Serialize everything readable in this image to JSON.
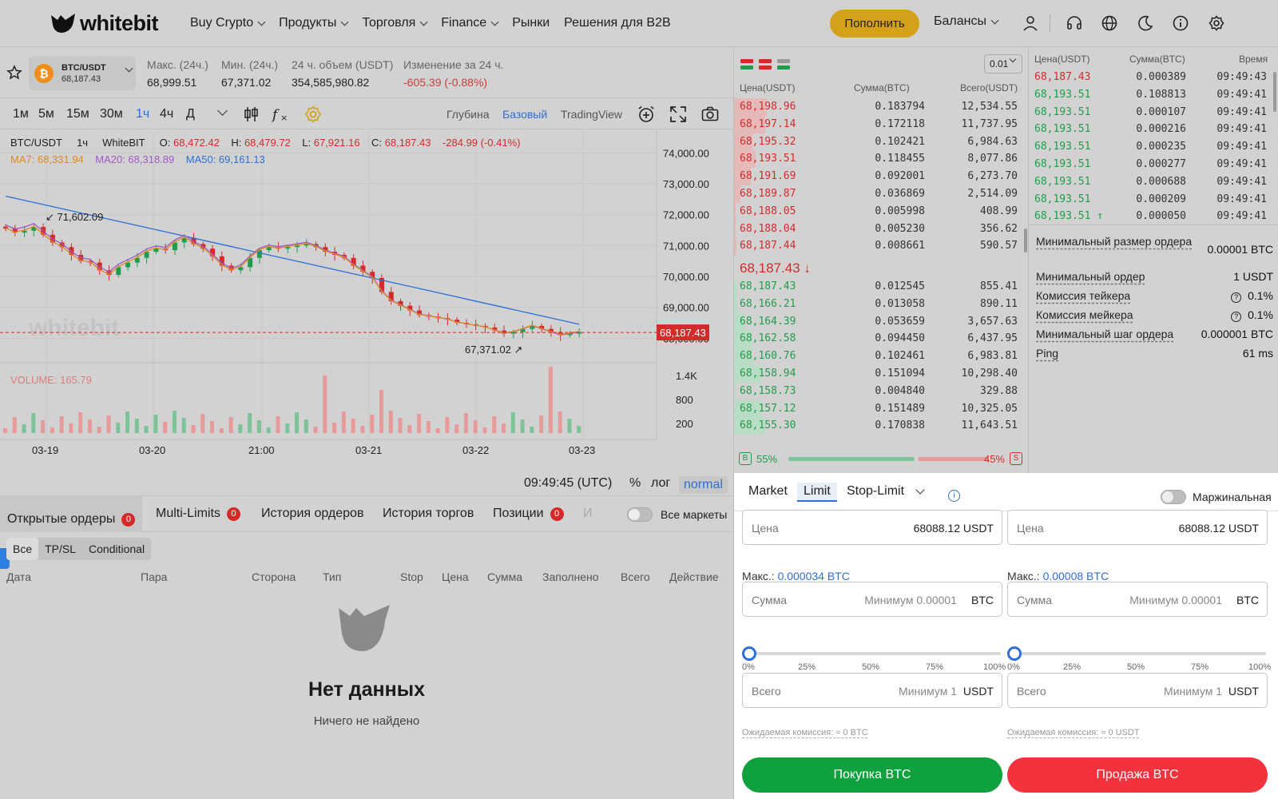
{
  "header": {
    "logo_text": "whitebit",
    "nav": [
      {
        "label": "Buy Crypto",
        "dropdown": true
      },
      {
        "label": "Продукты",
        "dropdown": true
      },
      {
        "label": "Торговля",
        "dropdown": true
      },
      {
        "label": "Finance",
        "dropdown": true
      },
      {
        "label": "Рынки",
        "dropdown": false
      },
      {
        "label": "Решения для B2B",
        "dropdown": false
      }
    ],
    "deposit_label": "Пополнить",
    "balances_label": "Балансы",
    "icons": [
      "user-icon",
      "headset-icon",
      "globe-icon",
      "moon-icon",
      "info-icon",
      "gear-icon"
    ],
    "accent_color": "#d4a21a"
  },
  "ticker": {
    "pair": "BTC/USDT",
    "price": "68,187.43",
    "coin_symbol": "₿",
    "stats": [
      {
        "label": "Макс. (24ч.)",
        "value": "68,999.51"
      },
      {
        "label": "Мин. (24ч.)",
        "value": "67,371.02"
      },
      {
        "label": "24 ч. объем (USDT)",
        "value": "354,585,980.82"
      },
      {
        "label": "Изменение за 24 ч.",
        "value": "-605.39  (-0.88%)"
      }
    ]
  },
  "chart_toolbar": {
    "timeframes": [
      "1м",
      "5м",
      "15м",
      "30м",
      "1ч",
      "4ч",
      "Д"
    ],
    "active_timeframe": "1ч",
    "views": [
      "Глубина",
      "Базовый",
      "TradingView"
    ],
    "active_view": "Базовый"
  },
  "chart_legend": {
    "pair": "BTC/USDT",
    "interval": "1ч",
    "exchange": "WhiteBIT",
    "o_label": "O:",
    "o": "68,472.42",
    "h_label": "H:",
    "h": "68,479.72",
    "l_label": "L:",
    "l": "67,921.16",
    "c_label": "C:",
    "c": "68,187.43",
    "change": "-284.99 (-0.41%)",
    "ma7": "MA7: 68,331.94",
    "ma20": "MA20: 68,318.89",
    "ma50": "MA50: 69,161.13",
    "volume": "VOLUME: 165.79"
  },
  "chart_data": {
    "type": "candlestick",
    "price_axis": {
      "ticks": [
        "74,000.00",
        "73,000.00",
        "72,000.00",
        "71,000.00",
        "70,000.00",
        "69,000.00",
        "68,000.00"
      ],
      "range": [
        67000,
        74500
      ]
    },
    "volume_axis": {
      "ticks": [
        "1.4K",
        "800",
        "200"
      ]
    },
    "x_ticks": [
      "03-19",
      "03-20",
      "21:00",
      "03-21",
      "03-22",
      "03-23"
    ],
    "current_price_label": "68,187.43",
    "annotations": [
      {
        "text": "71,602.09",
        "kind": "high"
      },
      {
        "text": "67,371.02",
        "kind": "low"
      }
    ],
    "close_path": [
      71550,
      71420,
      71480,
      71600,
      71350,
      71100,
      70950,
      70700,
      70500,
      70450,
      70200,
      70050,
      70300,
      70450,
      70600,
      70800,
      70900,
      70850,
      71100,
      71250,
      71050,
      70900,
      70650,
      70350,
      70200,
      70300,
      70600,
      70850,
      70950,
      70900,
      70950,
      71000,
      71050,
      70950,
      70800,
      70700,
      70600,
      70350,
      70150,
      69950,
      69500,
      69200,
      69050,
      68900,
      68750,
      68700,
      68650,
      68600,
      68500,
      68450,
      68400,
      68350,
      68250,
      68150,
      68200,
      68300,
      68400,
      68300,
      68200,
      68100,
      68150,
      68200
    ],
    "volume_colors": {
      "up": "#7cc399",
      "down": "#e89a9a"
    },
    "ma_colors": {
      "ma7": "#e08a1e",
      "ma20": "#9e5bc6",
      "ma50": "#2d6fd8"
    }
  },
  "time_bar": {
    "clock": "09:49:45 (UTC)",
    "percent": "%",
    "log": "лог",
    "normal": "normal"
  },
  "orders": {
    "tabs": [
      {
        "label": "Открытые ордеры",
        "badge": "0"
      },
      {
        "label": "Multi-Limits",
        "badge": "0"
      },
      {
        "label": "История ордеров",
        "badge": ""
      },
      {
        "label": "История торгов",
        "badge": ""
      },
      {
        "label": "Позиции",
        "badge": "0"
      },
      {
        "label": "И",
        "badge": ""
      }
    ],
    "all_markets_label": "Все маркеты",
    "filters": [
      "Все",
      "TP/SL",
      "Conditional"
    ],
    "columns": [
      "Дата",
      "Пара",
      "Сторона",
      "Тип",
      "Stop",
      "Цена",
      "Сумма",
      "Заполнено",
      "Всего",
      "Действие"
    ],
    "empty_title": "Нет данных",
    "empty_subtitle": "Ничего не найдено"
  },
  "orderbook": {
    "precision": "0.01",
    "headers": [
      "Цена(USDT)",
      "Сумма(BTC)",
      "Всего(USDT)"
    ],
    "asks": [
      {
        "price": "68,198.96",
        "amount": "0.183794",
        "total": "12,534.55",
        "depth": 0.46
      },
      {
        "price": "68,197.14",
        "amount": "0.172118",
        "total": "11,737.95",
        "depth": 0.43
      },
      {
        "price": "68,195.32",
        "amount": "0.102421",
        "total": "6,984.63",
        "depth": 0.26
      },
      {
        "price": "68,193.51",
        "amount": "0.118455",
        "total": "8,077.86",
        "depth": 0.3
      },
      {
        "price": "68,191.69",
        "amount": "0.092001",
        "total": "6,273.70",
        "depth": 0.23
      },
      {
        "price": "68,189.87",
        "amount": "0.036869",
        "total": "2,514.09",
        "depth": 0.09
      },
      {
        "price": "68,188.05",
        "amount": "0.005998",
        "total": "408.99",
        "depth": 0.02
      },
      {
        "price": "68,188.04",
        "amount": "0.005230",
        "total": "356.62",
        "depth": 0.02
      },
      {
        "price": "68,187.44",
        "amount": "0.008661",
        "total": "590.57",
        "depth": 0.03
      }
    ],
    "mid_price": "68,187.43 ↓",
    "bids": [
      {
        "price": "68,187.43",
        "amount": "0.012545",
        "total": "855.41",
        "depth": 0.04
      },
      {
        "price": "68,166.21",
        "amount": "0.013058",
        "total": "890.11",
        "depth": 0.04
      },
      {
        "price": "68,164.39",
        "amount": "0.053659",
        "total": "3,657.63",
        "depth": 0.14
      },
      {
        "price": "68,162.58",
        "amount": "0.094450",
        "total": "6,437.95",
        "depth": 0.24
      },
      {
        "price": "68,160.76",
        "amount": "0.102461",
        "total": "6,983.81",
        "depth": 0.26
      },
      {
        "price": "68,158.94",
        "amount": "0.151094",
        "total": "10,298.40",
        "depth": 0.38
      },
      {
        "price": "68,158.73",
        "amount": "0.004840",
        "total": "329.88",
        "depth": 0.02
      },
      {
        "price": "68,157.12",
        "amount": "0.151489",
        "total": "10,325.05",
        "depth": 0.38
      },
      {
        "price": "68,155.30",
        "amount": "0.170838",
        "total": "11,643.51",
        "depth": 0.43
      }
    ],
    "buy_letter": "B",
    "sell_letter": "S",
    "buy_pct": "55%",
    "sell_pct": "45%"
  },
  "trades": {
    "headers": [
      "Цена(USDT)",
      "Сумма(BTC)",
      "Время"
    ],
    "rows": [
      {
        "price": "68,187.43",
        "amount": "0.000389",
        "time": "09:49:43",
        "side": "sell"
      },
      {
        "price": "68,193.51",
        "amount": "0.108813",
        "time": "09:49:41",
        "side": "buy"
      },
      {
        "price": "68,193.51",
        "amount": "0.000107",
        "time": "09:49:41",
        "side": "buy"
      },
      {
        "price": "68,193.51",
        "amount": "0.000216",
        "time": "09:49:41",
        "side": "buy"
      },
      {
        "price": "68,193.51",
        "amount": "0.000235",
        "time": "09:49:41",
        "side": "buy"
      },
      {
        "price": "68,193.51",
        "amount": "0.000277",
        "time": "09:49:41",
        "side": "buy"
      },
      {
        "price": "68,193.51",
        "amount": "0.000688",
        "time": "09:49:41",
        "side": "buy"
      },
      {
        "price": "68,193.51",
        "amount": "0.000209",
        "time": "09:49:41",
        "side": "buy"
      },
      {
        "price": "68,193.51 ↑",
        "amount": "0.000050",
        "time": "09:49:41",
        "side": "buy"
      }
    ]
  },
  "market_info": [
    {
      "label": "Минимальный размер ордера",
      "value": "0.00001 BTC",
      "help": false
    },
    {
      "label": "Минимальный ордер",
      "value": "1 USDT",
      "help": false
    },
    {
      "label": "Комиссия тейкера",
      "value": "0.1%",
      "help": true
    },
    {
      "label": "Комиссия мейкера",
      "value": "0.1%",
      "help": true
    },
    {
      "label": "Минимальный шаг ордера",
      "value": "0.000001 BTC",
      "help": false
    },
    {
      "label": "Ping",
      "value": "61 ms",
      "help": false
    }
  ],
  "order_form": {
    "tabs": [
      "Market",
      "Limit",
      "Stop-Limit"
    ],
    "active_tab": "Limit",
    "margin_label": "Маржинальная",
    "buy": {
      "price_label": "Цена",
      "price_value": "68088.12",
      "price_unit": "USDT",
      "max_label": "Макс.:",
      "max_value": "0.000034 BTC",
      "amount_label": "Сумма",
      "amount_placeholder": "Минимум 0.00001",
      "amount_unit": "BTC",
      "total_label": "Всего",
      "total_placeholder": "Минимум 1",
      "total_unit": "USDT",
      "fee": "Ожидаемая комиссия: ≈ 0 BTC",
      "button": "Покупка BTC",
      "slider_pct": 0
    },
    "sell": {
      "price_label": "Цена",
      "price_value": "68088.12",
      "price_unit": "USDT",
      "max_label": "Макс.:",
      "max_value": "0.00008 BTC",
      "amount_label": "Сумма",
      "amount_placeholder": "Минимум 0.00001",
      "amount_unit": "BTC",
      "total_label": "Всего",
      "total_placeholder": "Минимум 1",
      "total_unit": "USDT",
      "fee": "Ожидаемая комиссия: ≈ 0 USDT",
      "button": "Продажа BTC",
      "slider_pct": 0
    },
    "slider_marks": [
      "0%",
      "25%",
      "50%",
      "75%",
      "100%"
    ],
    "buy_color": "#0fa13d",
    "sell_color": "#f2323c"
  }
}
